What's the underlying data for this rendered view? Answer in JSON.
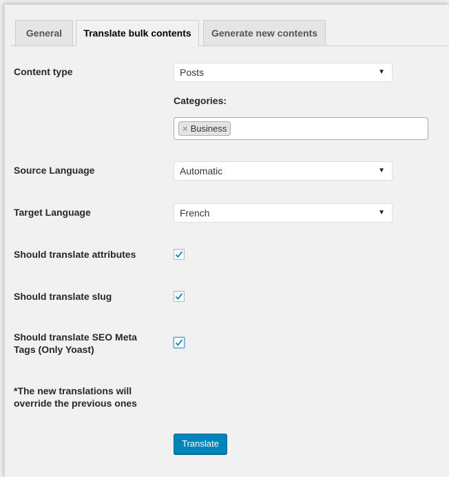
{
  "tabs": [
    {
      "label": "General"
    },
    {
      "label": "Translate bulk contents"
    },
    {
      "label": "Generate new contents"
    }
  ],
  "content_type": {
    "label": "Content type",
    "value": "Posts"
  },
  "categories": {
    "label": "Categories:",
    "chips": [
      "Business"
    ],
    "remove_glyph": "×"
  },
  "source_language": {
    "label": "Source Language",
    "value": "Automatic"
  },
  "target_language": {
    "label": "Target Language",
    "value": "French"
  },
  "options": [
    {
      "label": "Should translate attributes",
      "checked": true
    },
    {
      "label": "Should translate slug",
      "checked": true
    },
    {
      "label_line1": "Should translate SEO Meta",
      "label_line2": "Tags (Only Yoast)",
      "checked": true
    }
  ],
  "note": {
    "line1": "*The new translations will",
    "line2": "override the previous ones"
  },
  "submit": {
    "label": "Translate"
  },
  "colors": {
    "primary_button": "#0085ba",
    "checkmark": "#1e8cbe"
  }
}
